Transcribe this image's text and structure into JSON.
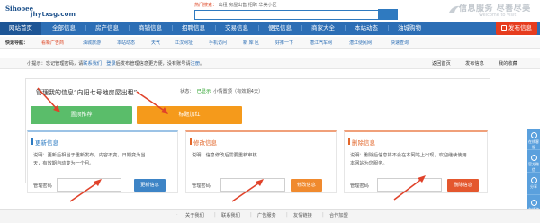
{
  "header": {
    "logo_mark": "Sihooee",
    "logo_cn": "ihqtxsg",
    "logo_domain": "jhytxsg.com",
    "hotsearch_label": "热门搜索：",
    "hotsearch_items": [
      "出租",
      "房屋出售",
      "招聘",
      "华美小区"
    ],
    "slogan_cn": "信息服务 尽善尽美",
    "slogan_en": "Welcome to visit"
  },
  "nav": {
    "items": [
      "网站首页",
      "全部信息",
      "房产信息",
      "商铺信息",
      "招聘信息",
      "交易信息",
      "便民信息",
      "商家大全",
      "本站动态",
      "油城购物"
    ],
    "active_index": 0,
    "publish_label": "发布信息"
  },
  "quick": {
    "title": "快速导航：",
    "items": [
      "看新广告商",
      "油城旅游",
      "本站动态",
      "天气",
      "江汉网址",
      "手机访问",
      "新 库 区",
      "好推一下",
      "潜江汽车网",
      "潜江便民网",
      "快速查询"
    ]
  },
  "tip": {
    "label": "小提示：",
    "text_1": "忘记管理密码，请",
    "contact": "联系我们",
    "text_2": "！",
    "login": "登录",
    "text_3": "后发布管理信息更方便，没有账号请",
    "register": "注册",
    "text_4": "。",
    "links": [
      "返回首页",
      "发布信息",
      "我的收藏"
    ]
  },
  "manage": {
    "title": "管理我的信息“向阳七号地房屋出租”",
    "status_label": "状态：",
    "status_value": "已显示",
    "status_extra": "小情置顶（有效期4天）",
    "top_button": "置顶推荐",
    "red_button": "标题加红"
  },
  "boxes": [
    {
      "title": "更新信息",
      "desc": "说明：更新后相当于重新发布，内容不变，日期变为当天，有效期自动变为一个月。",
      "pw_label": "管理密码",
      "button": "更新信息"
    },
    {
      "title": "修改信息",
      "desc": "说明：信息修改后需要重新审核",
      "pw_label": "管理密码",
      "button": "修改信息"
    },
    {
      "title": "删除信息",
      "desc": "说明：删除后信息将不会在本网站上出现，欢迎继续使用本网站为您服务。",
      "pw_label": "管理密码",
      "button": "删除信息"
    }
  ],
  "side": {
    "items": [
      "在线客服",
      "官方微信",
      "分享",
      "在线咨询"
    ]
  },
  "footer": {
    "links": [
      "关于我们",
      "联系我们",
      "广告服务",
      "友情链接",
      "合作加盟"
    ]
  },
  "colors": {
    "nav_bg": "#2c6eb5",
    "publish": "#e63c1e",
    "top_button": "#5abd6a",
    "red_button": "#f59a1b",
    "arrow": "#e0422a"
  }
}
